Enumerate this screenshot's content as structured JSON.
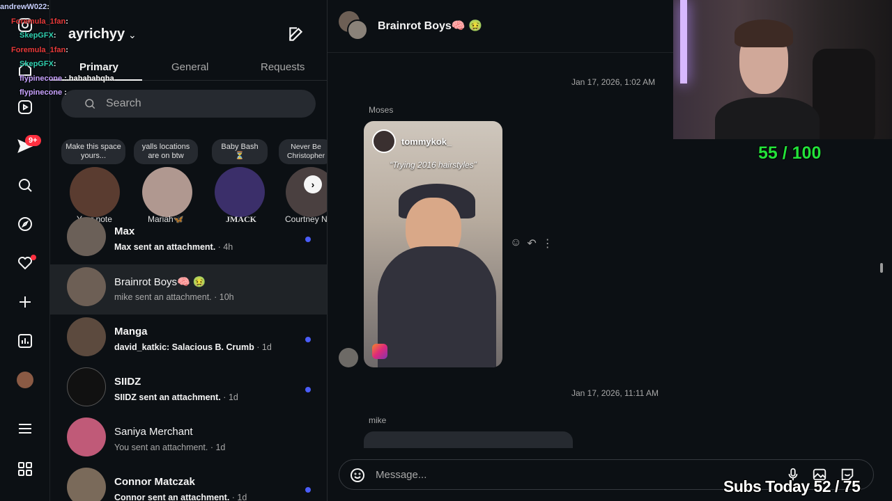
{
  "chat_overlay": [
    {
      "user": "andrewW022",
      "text": "",
      "color": "#c9d1ff"
    },
    {
      "user": "Foremula_1fan",
      "text": "",
      "color": "#e83a3a"
    },
    {
      "user": "SkepGFX",
      "text": "",
      "color": "#2fd0b0"
    },
    {
      "user": "Foremula_1fan",
      "text": "",
      "color": "#e83a3a"
    },
    {
      "user": "SkepGFX",
      "text": "",
      "color": "#2fd0b0"
    },
    {
      "user": "flypinecone",
      "text": "hahahahqha",
      "color": "#c8a2ff"
    },
    {
      "user": "flypinecone",
      "text": "",
      "color": "#c8a2ff"
    }
  ],
  "rail": {
    "notification_badge": "9+"
  },
  "inbox": {
    "account": "ayrichyy",
    "tabs": [
      "Primary",
      "General",
      "Requests"
    ],
    "search_placeholder": "Search",
    "notes": [
      {
        "bubble": "Make this space yours...",
        "name": "Your note"
      },
      {
        "bubble": "yalls locations are on btw",
        "name": "Mariah🦋"
      },
      {
        "bubble": "Baby Bash ⏳",
        "name": "JMACK"
      },
      {
        "bubble": "Never Be Christopher",
        "name": "Courtney N"
      }
    ],
    "threads": [
      {
        "name": "Max",
        "preview": "Max sent an attachment.",
        "time": "4h",
        "unread": true
      },
      {
        "name": "Brainrot Boys🧠 🤢",
        "preview": "mike sent an attachment.",
        "time": "10h",
        "unread": false
      },
      {
        "name": "Manga",
        "preview": "david_katkic: Salacious B. Crumb",
        "time": "1d",
        "unread": true
      },
      {
        "name": "SIIDZ",
        "preview": "SIIDZ sent an attachment.",
        "time": "1d",
        "unread": true
      },
      {
        "name": "Saniya Merchant",
        "preview": "You sent an attachment.",
        "time": "1d",
        "unread": false
      },
      {
        "name": "Connor Matczak",
        "preview": "Connor sent an attachment.",
        "time": "1d",
        "unread": true
      }
    ]
  },
  "chat": {
    "title": "Brainrot Boys🧠 🤢",
    "timestamp_1": "Jan 17, 2026, 1:02 AM",
    "sender_1": "Moses",
    "reel_user": "tommykok_",
    "reel_caption": "“Trying 2016 hairstyles”",
    "timestamp_2": "Jan 17, 2026, 11:11 AM",
    "sender_2": "mike",
    "composer_placeholder": "Message..."
  },
  "stream": {
    "score": "55 / 100",
    "subs": "Subs Today  52 / 75"
  }
}
